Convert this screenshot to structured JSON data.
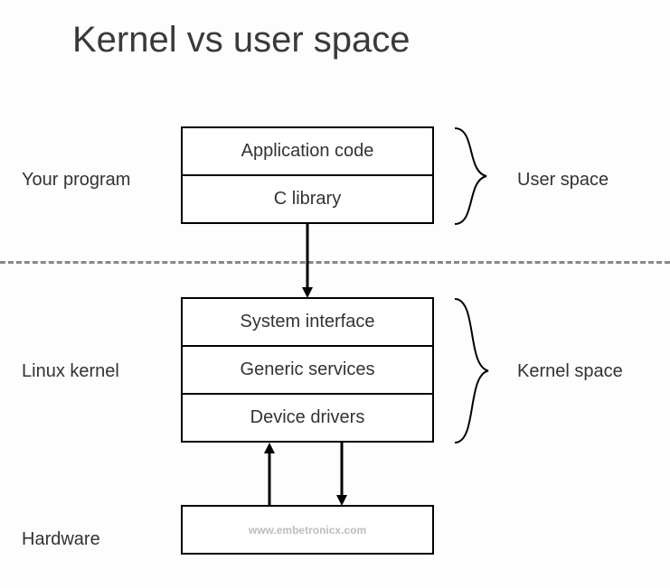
{
  "title": "Kernel vs user space",
  "labels": {
    "your_program": "Your program",
    "linux_kernel": "Linux kernel",
    "hardware": "Hardware",
    "user_space": "User space",
    "kernel_space": "Kernel space"
  },
  "boxes": {
    "app_code": "Application code",
    "c_lib": "C library",
    "sys_interface": "System interface",
    "generic_services": "Generic services",
    "device_drivers": "Device drivers"
  },
  "watermark": "www.embetronicx.com"
}
